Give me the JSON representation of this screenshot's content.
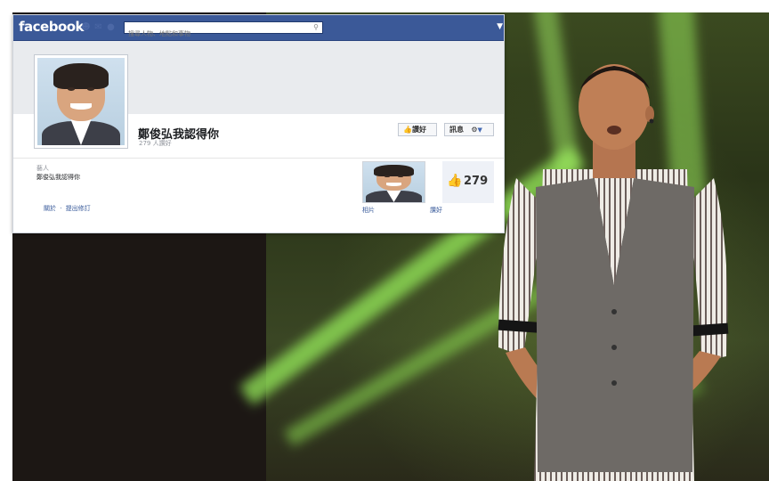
{
  "facebook": {
    "logo": "facebook",
    "search": {
      "placeholder": "搜尋人物、地點和事物"
    },
    "page": {
      "name": "鄭俊弘我認得你",
      "meta": "279 人讚好",
      "category": "藝人",
      "description": "鄭俊弘我認得你",
      "links": [
        "關於",
        "提出修訂"
      ]
    },
    "buttons": {
      "like": "讚好",
      "message": "訊息"
    },
    "photos_label": "相片",
    "likes": {
      "count": "279",
      "label": "讚好"
    }
  },
  "colors": {
    "fb_blue": "#3b5998",
    "link_blue": "#365899",
    "stage_green": "#8fd14f"
  }
}
